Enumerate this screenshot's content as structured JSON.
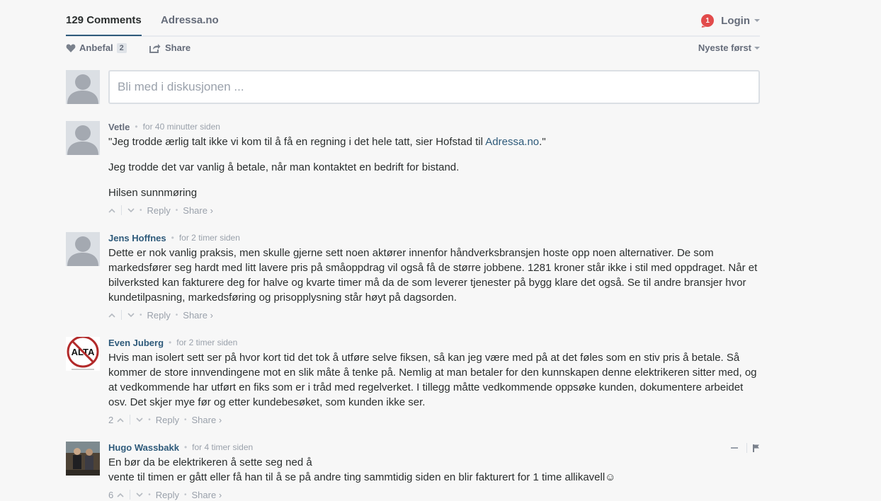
{
  "nav": {
    "comments_tab": "129 Comments",
    "site_tab": "Adressa.no",
    "notification_count": "1",
    "login_label": "Login"
  },
  "toolbar": {
    "recommend_label": "Anbefal",
    "recommend_count": "2",
    "share_label": "Share",
    "sort_label": "Nyeste først"
  },
  "composer": {
    "placeholder": "Bli med i diskusjonen ..."
  },
  "actions": {
    "reply": "Reply",
    "share": "Share ›"
  },
  "comments": [
    {
      "author": "Vetle",
      "time": "for 40 minutter siden",
      "p1_pre": "\"Jeg trodde ærlig talt ikke vi kom til å få en regning i det hele tatt, sier Hofstad til ",
      "p1_link": "Adressa.no",
      "p1_post": ".\"",
      "p2": "Jeg trodde det var vanlig å betale, når man kontaktet en bedrift for bistand.",
      "p3": "Hilsen sunnmøring",
      "upvotes": ""
    },
    {
      "author": "Jens Hoffnes",
      "time": "for 2 timer siden",
      "text": "Dette er nok vanlig praksis, men skulle gjerne sett noen aktører innenfor håndverksbransjen hoste opp noen alternativer. De som markedsfører seg hardt med litt lavere pris på småoppdrag vil også få de større jobbene. 1281 kroner står ikke i stil med oppdraget. Når et bilverksted kan fakturere deg for halve og kvarte timer må da de som leverer tjenester på bygg klare det også. Se til andre bransjer hvor kundetilpasning, markedsføring og prisopplysning står høyt på dagsorden.",
      "upvotes": ""
    },
    {
      "author": "Even Juberg",
      "time": "for 2 timer siden",
      "text": "Hvis man isolert sett ser på hvor kort tid det tok å utføre selve fiksen, så kan jeg være med på at det føles som en stiv pris å betale. Så kommer de store innvendingene mot en slik måte å tenke på. Nemlig at man betaler for den kunnskapen denne elektrikeren sitter med, og at vedkommende har utført en fiks som er i tråd med regelverket. I tillegg måtte vedkommende oppsøke kunden, dokumentere arbeidet osv. Det skjer mye før og etter kundebesøket, som kunden ikke ser.",
      "upvotes": "2",
      "avatar_text": "ALTA"
    },
    {
      "author": "Hugo Wassbakk",
      "time": "for 4 timer siden",
      "line1": "En bør da be elektrikeren å sette seg ned å",
      "line2": "vente til timen er gått eller få han til å se på andre ting sammtidig siden en blir fakturert for 1 time allikavell☺",
      "upvotes": "6"
    }
  ]
}
